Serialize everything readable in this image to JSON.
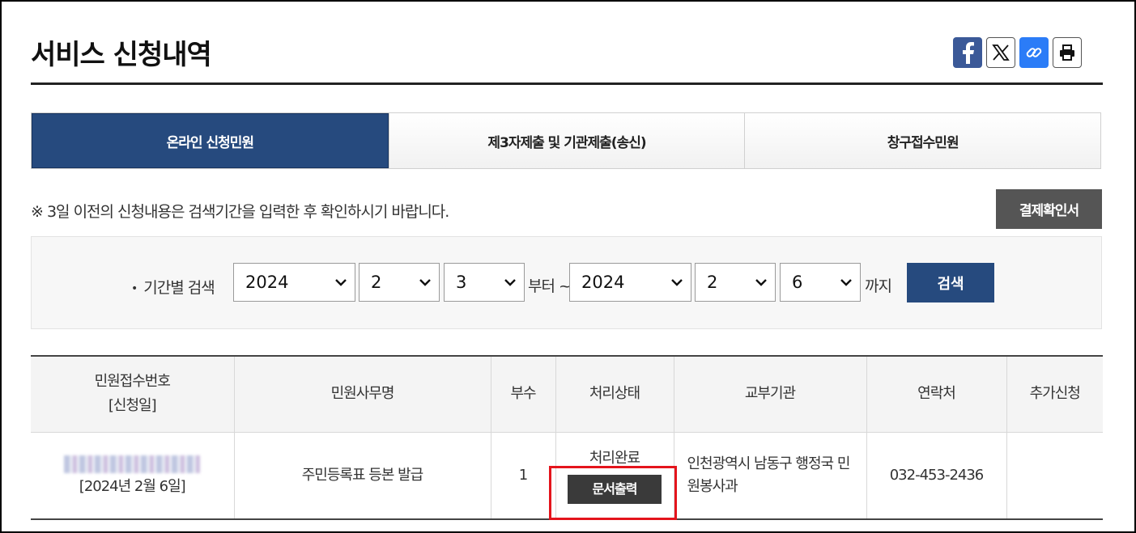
{
  "page": {
    "title": "서비스 신청내역"
  },
  "share": {
    "icons": [
      "facebook-icon",
      "x-icon",
      "link-icon",
      "print-icon"
    ],
    "colors": {
      "facebook": "#3b5998",
      "link": "#2b7cf7"
    }
  },
  "tabs": [
    {
      "label": "온라인 신청민원",
      "active": true
    },
    {
      "label": "제3자제출 및 기관제출(송신)",
      "active": false
    },
    {
      "label": "창구접수민원",
      "active": false
    }
  ],
  "notice": "※ 3일 이전의 신청내용은 검색기간을 입력한 후 확인하시기 바랍니다.",
  "receipt_button": "결제확인서",
  "search": {
    "label": "기간별 검색",
    "from": {
      "year": "2024",
      "month": "2",
      "day": "3"
    },
    "from_suffix": "부터 ~",
    "to": {
      "year": "2024",
      "month": "2",
      "day": "6"
    },
    "to_suffix": "까지",
    "button": "검색"
  },
  "table": {
    "headers": {
      "receipt_no": "민원접수번호",
      "apply_date": "[신청일]",
      "name": "민원사무명",
      "copies": "부수",
      "status": "처리상태",
      "org": "교부기관",
      "contact": "연락처",
      "extra": "추가신청"
    },
    "rows": [
      {
        "date": "[2024년 2월 6일]",
        "name": "주민등록표 등본 발급",
        "copies": "1",
        "status": "처리완료",
        "print_button": "문서출력",
        "org": "인천광역시 남동구 행정국 민원봉사과",
        "contact": "032-453-2436",
        "extra": ""
      }
    ]
  },
  "colors": {
    "primary": "#264a7e",
    "dark_button": "#555555",
    "highlight": "#e4141c"
  }
}
